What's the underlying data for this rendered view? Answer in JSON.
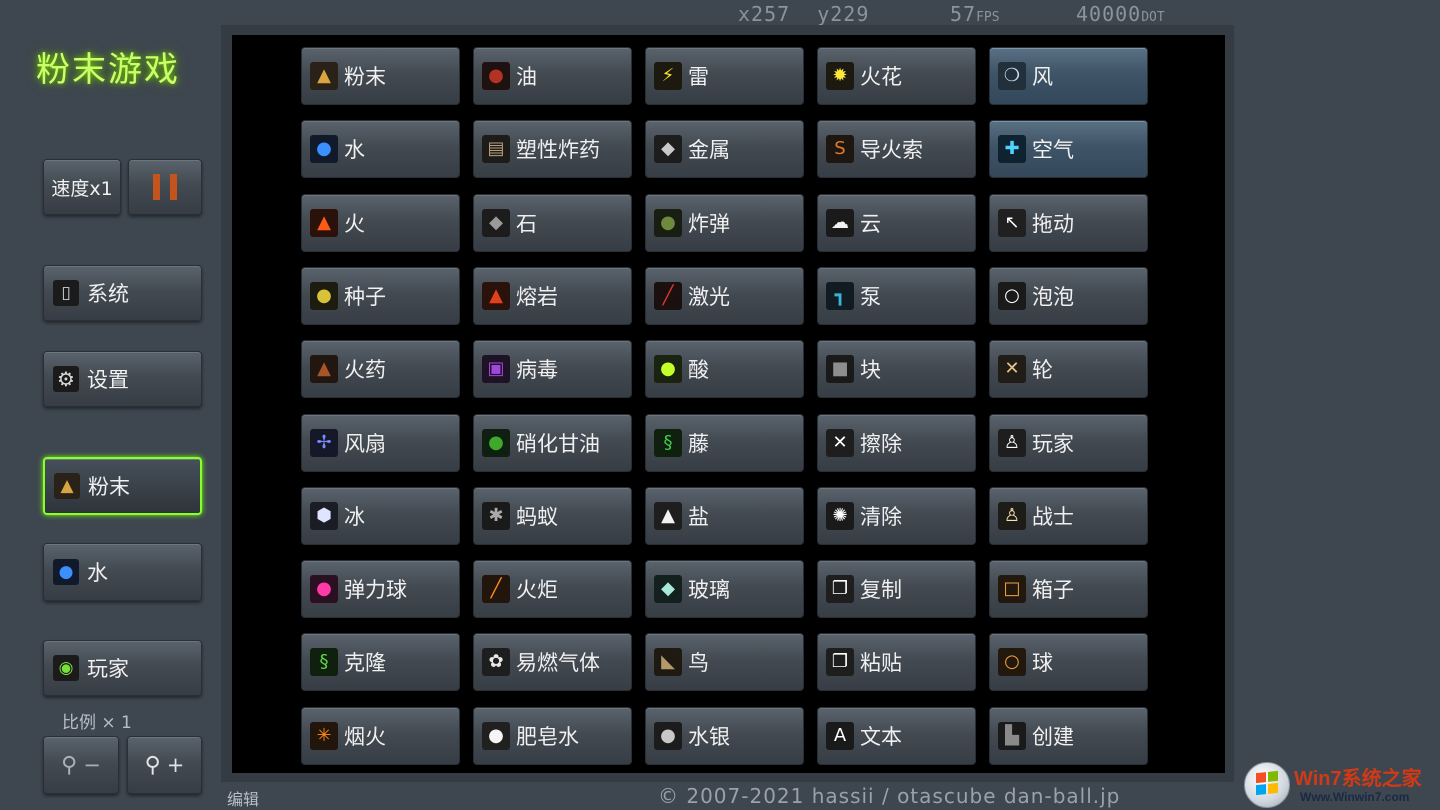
{
  "hud": {
    "x_readout": "x257",
    "y_readout": "y229",
    "fps_value": "57",
    "fps_unit": "FPS",
    "dot_value": "40000",
    "dot_unit": "DOT"
  },
  "app_title": "粉末游戏",
  "sidebar": {
    "speed_label": "速度x1",
    "system_label": "系统",
    "settings_label": "设置",
    "selected_primary_label": "粉末",
    "selected_secondary_label": "水",
    "player_label": "玩家",
    "scale_label": "比例 × 1",
    "zoom_out_label": "−",
    "zoom_in_label": "+"
  },
  "elements": [
    {
      "label": "粉末",
      "icon": "powder-icon",
      "glyph": "▲",
      "color": "#d9a441",
      "bg": "#2a2218"
    },
    {
      "label": "油",
      "icon": "oil-icon",
      "glyph": "●",
      "color": "#b23323",
      "bg": "#1e1110"
    },
    {
      "label": "雷",
      "icon": "thunder-icon",
      "glyph": "⚡",
      "color": "#ffe22a",
      "bg": "#1c1a10"
    },
    {
      "label": "火花",
      "icon": "spark-icon",
      "glyph": "✹",
      "color": "#ffe83a",
      "bg": "#1c1a10"
    },
    {
      "label": "风",
      "icon": "wind-icon",
      "glyph": "❍",
      "color": "#c7d8e8",
      "bg": "#22303c",
      "highlight": true
    },
    {
      "label": "水",
      "icon": "water-icon",
      "glyph": "●",
      "color": "#3b8fff",
      "bg": "#101a2a"
    },
    {
      "label": "塑性炸药",
      "icon": "c4-icon",
      "glyph": "▤",
      "color": "#b8a079",
      "bg": "#1e1c18"
    },
    {
      "label": "金属",
      "icon": "metal-icon",
      "glyph": "◆",
      "color": "#c9c9c9",
      "bg": "#1d1d1d"
    },
    {
      "label": "导火索",
      "icon": "fuse-icon",
      "glyph": "S",
      "color": "#e07a2a",
      "bg": "#1e1610"
    },
    {
      "label": "空气",
      "icon": "air-icon",
      "glyph": "✚",
      "color": "#4fd2ff",
      "bg": "#0f2230",
      "highlight": true
    },
    {
      "label": "火",
      "icon": "fire-icon",
      "glyph": "▲",
      "color": "#ff5a18",
      "bg": "#2a120a"
    },
    {
      "label": "石",
      "icon": "stone-icon",
      "glyph": "◆",
      "color": "#9a9a9a",
      "bg": "#1c1c1c"
    },
    {
      "label": "炸弹",
      "icon": "bomb-icon",
      "glyph": "●",
      "color": "#6e8a3d",
      "bg": "#181e12"
    },
    {
      "label": "云",
      "icon": "cloud-icon",
      "glyph": "☁",
      "color": "#f2f2f2",
      "bg": "#1a1a1a"
    },
    {
      "label": "拖动",
      "icon": "drag-icon",
      "glyph": "↖",
      "color": "#ffffff",
      "bg": "#202020"
    },
    {
      "label": "种子",
      "icon": "seed-icon",
      "glyph": "●",
      "color": "#d7c23a",
      "bg": "#1d1c10"
    },
    {
      "label": "熔岩",
      "icon": "magma-icon",
      "glyph": "▲",
      "color": "#e2401a",
      "bg": "#2a120c"
    },
    {
      "label": "激光",
      "icon": "laser-icon",
      "glyph": "╱",
      "color": "#e0382a",
      "bg": "#1a1010"
    },
    {
      "label": "泵",
      "icon": "pump-icon",
      "glyph": "┓",
      "color": "#3bb4d8",
      "bg": "#101c22"
    },
    {
      "label": "泡泡",
      "icon": "bubble-icon",
      "glyph": "○",
      "color": "#ffffff",
      "bg": "#1a1a1a"
    },
    {
      "label": "火药",
      "icon": "gunpowder-icon",
      "glyph": "▲",
      "color": "#a8552a",
      "bg": "#221610"
    },
    {
      "label": "病毒",
      "icon": "virus-icon",
      "glyph": "▣",
      "color": "#a445e0",
      "bg": "#1e1226"
    },
    {
      "label": "酸",
      "icon": "acid-icon",
      "glyph": "●",
      "color": "#c4ff2a",
      "bg": "#1a2210"
    },
    {
      "label": "块",
      "icon": "block-icon",
      "glyph": "■",
      "color": "#8e8e8e",
      "bg": "#1a1a1a"
    },
    {
      "label": "轮",
      "icon": "wheel-icon",
      "glyph": "✕",
      "color": "#e6c48a",
      "bg": "#201c16"
    },
    {
      "label": "风扇",
      "icon": "fan-icon",
      "glyph": "✢",
      "color": "#7a8cff",
      "bg": "#141828"
    },
    {
      "label": "硝化甘油",
      "icon": "nitro-icon",
      "glyph": "●",
      "color": "#3faa2a",
      "bg": "#102010"
    },
    {
      "label": "藤",
      "icon": "vine-icon",
      "glyph": "§",
      "color": "#3fcf4a",
      "bg": "#10200f"
    },
    {
      "label": "擦除",
      "icon": "erase-icon",
      "glyph": "✕",
      "color": "#ffffff",
      "bg": "#1e1e1e"
    },
    {
      "label": "玩家",
      "icon": "player-icon",
      "glyph": "♙",
      "color": "#ffffff",
      "bg": "#1e1e1e"
    },
    {
      "label": "冰",
      "icon": "ice-icon",
      "glyph": "⬢",
      "color": "#dfe4ff",
      "bg": "#1a1c26"
    },
    {
      "label": "蚂蚁",
      "icon": "ant-icon",
      "glyph": "✱",
      "color": "#aaaaaa",
      "bg": "#1a1a1a"
    },
    {
      "label": "盐",
      "icon": "salt-icon",
      "glyph": "▲",
      "color": "#f2f2f2",
      "bg": "#1e1e1e"
    },
    {
      "label": "清除",
      "icon": "clear-icon",
      "glyph": "✺",
      "color": "#ffffff",
      "bg": "#1a1a1a"
    },
    {
      "label": "战士",
      "icon": "fighter-icon",
      "glyph": "♙",
      "color": "#f7e2b0",
      "bg": "#1e1c18"
    },
    {
      "label": "弹力球",
      "icon": "ball-icon",
      "glyph": "●",
      "color": "#ff3aa8",
      "bg": "#2a1020"
    },
    {
      "label": "火炬",
      "icon": "torch-icon",
      "glyph": "╱",
      "color": "#ff8a18",
      "bg": "#22160c"
    },
    {
      "label": "玻璃",
      "icon": "glass-icon",
      "glyph": "◆",
      "color": "#a8e8d8",
      "bg": "#14201e"
    },
    {
      "label": "复制",
      "icon": "copy-icon",
      "glyph": "❐",
      "color": "#ffffff",
      "bg": "#1e1e1e"
    },
    {
      "label": "箱子",
      "icon": "box-icon",
      "glyph": "□",
      "color": "#f0a23a",
      "bg": "#22180e"
    },
    {
      "label": "克隆",
      "icon": "clone-icon",
      "glyph": "§",
      "color": "#5fd84a",
      "bg": "#10200f"
    },
    {
      "label": "易燃气体",
      "icon": "gas-icon",
      "glyph": "✿",
      "color": "#e8e8e8",
      "bg": "#1e1e1e"
    },
    {
      "label": "鸟",
      "icon": "bird-icon",
      "glyph": "◣",
      "color": "#b49a6a",
      "bg": "#1e1a12"
    },
    {
      "label": "粘贴",
      "icon": "paste-icon",
      "glyph": "❐",
      "color": "#ffffff",
      "bg": "#1e1e1e"
    },
    {
      "label": "球",
      "icon": "sphere-icon",
      "glyph": "○",
      "color": "#f0a23a",
      "bg": "#22180e"
    },
    {
      "label": "烟火",
      "icon": "firework-icon",
      "glyph": "✳",
      "color": "#ff8a18",
      "bg": "#22160c"
    },
    {
      "label": "肥皂水",
      "icon": "soapy-icon",
      "glyph": "●",
      "color": "#f5f5f5",
      "bg": "#202020"
    },
    {
      "label": "水银",
      "icon": "mercury-icon",
      "glyph": "●",
      "color": "#c8c8c8",
      "bg": "#1c1c1c"
    },
    {
      "label": "文本",
      "icon": "text-icon",
      "glyph": "A",
      "color": "#ffffff",
      "bg": "#1a1a1a"
    },
    {
      "label": "创建",
      "icon": "create-icon",
      "glyph": "▙",
      "color": "#8a8a8a",
      "bg": "#1a1a1a"
    }
  ],
  "footer": {
    "edit_label": "编辑",
    "copyright": "© 2007-2021 hassii / otascube dan-ball.jp"
  },
  "watermark": {
    "brand": "Win7系统之家",
    "url": "Www.Winwin7.com"
  }
}
